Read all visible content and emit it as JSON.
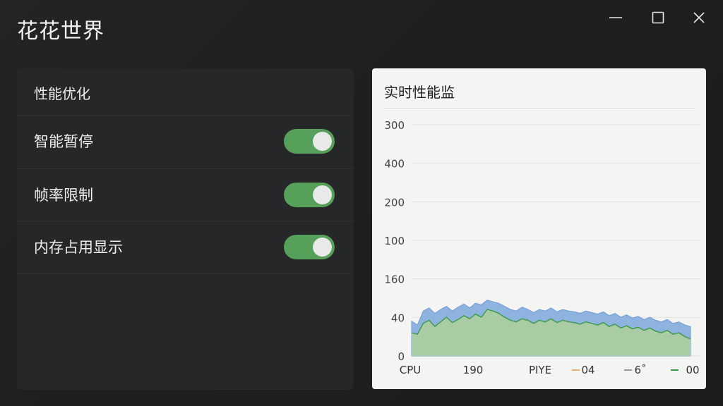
{
  "app": {
    "title": "花花世界"
  },
  "window_controls": {
    "minimize_icon": "minimize-icon",
    "maximize_icon": "maximize-icon",
    "close_icon": "close-icon"
  },
  "settings": {
    "section_title": "性能优化",
    "items": [
      {
        "label": "智能暂停",
        "enabled": true
      },
      {
        "label": "帧率限制",
        "enabled": true
      },
      {
        "label": "内存占用显示",
        "enabled": true
      }
    ]
  },
  "colors": {
    "toggle_on": "#57a05a",
    "series_blue": "#8fb3df",
    "series_green": "#a9cca5",
    "green_line": "#3a9a4a"
  },
  "monitor": {
    "title": "实时性能监"
  },
  "chart_data": {
    "type": "area",
    "y_tick_labels": [
      "300",
      "400",
      "200",
      "100",
      "160",
      "40",
      "0"
    ],
    "x_tick_labels": [
      "CPU",
      "190",
      "PIYE",
      "04",
      "6˚",
      "00"
    ],
    "legend_markers": [
      {
        "label": "04",
        "color": "#e7b07a"
      },
      {
        "label": "6˚",
        "color": "#999999"
      },
      {
        "label": "00",
        "color": "#3a9a4a"
      }
    ],
    "grid": true,
    "series": [
      {
        "values": [
          45,
          40,
          58,
          62,
          55,
          60,
          64,
          58,
          63,
          67,
          62,
          68,
          66,
          72,
          70,
          68,
          64,
          60,
          58,
          63,
          60,
          56,
          60,
          58,
          62,
          57,
          60,
          58,
          57,
          55,
          58,
          56,
          54,
          57,
          52,
          55,
          50,
          53,
          49,
          51,
          47,
          50,
          46,
          44,
          47,
          42,
          44,
          40,
          38
        ]
      },
      {
        "values": [
          30,
          28,
          42,
          46,
          38,
          44,
          50,
          43,
          47,
          52,
          48,
          54,
          50,
          60,
          58,
          55,
          50,
          46,
          44,
          48,
          46,
          42,
          46,
          44,
          48,
          43,
          46,
          44,
          43,
          41,
          44,
          42,
          40,
          43,
          38,
          41,
          36,
          39,
          35,
          37,
          33,
          36,
          32,
          30,
          33,
          28,
          30,
          25,
          22
        ]
      }
    ]
  }
}
